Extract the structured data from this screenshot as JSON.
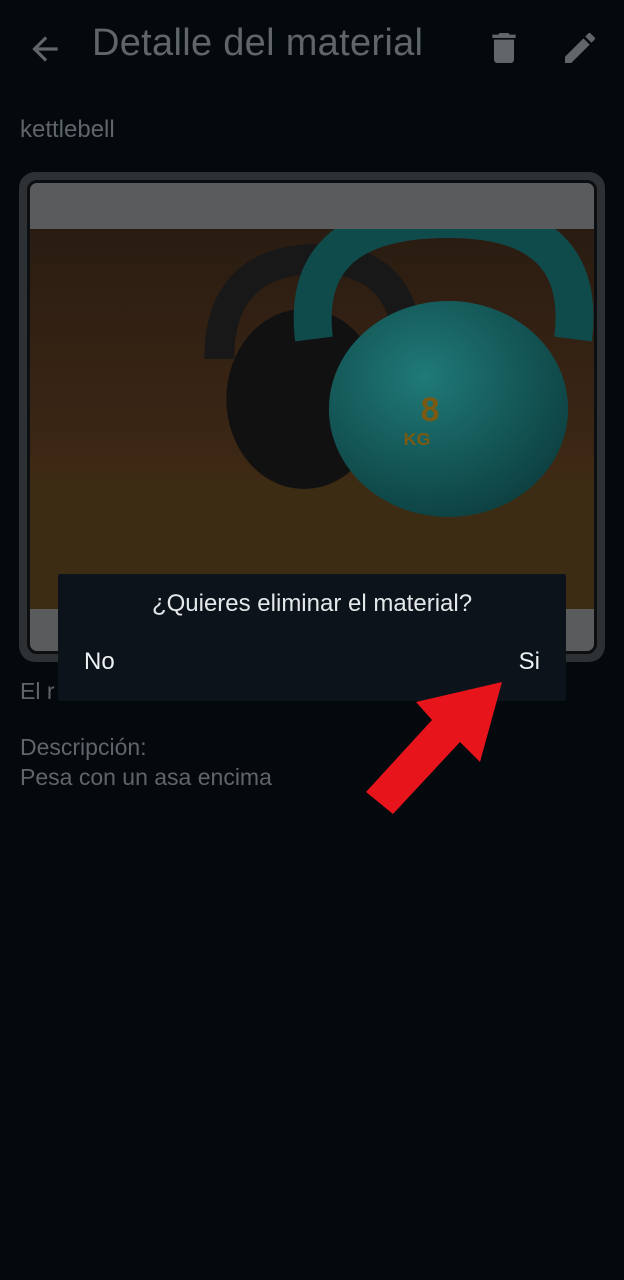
{
  "appbar": {
    "title": "Detalle del material",
    "back_icon": "arrow-left-icon",
    "delete_icon": "trash-icon",
    "edit_icon": "pencil-icon"
  },
  "material": {
    "name": "kettlebell",
    "availability_partial": "El r",
    "description_label": "Descripción:",
    "description": "Pesa con un asa encima",
    "photo_weight_text": "8",
    "photo_unit_text": "KG"
  },
  "dialog": {
    "question": "¿Quieres eliminar el material?",
    "no_label": "No",
    "yes_label": "Si"
  },
  "colors": {
    "background": "#03090d",
    "dialog_bg": "#0d131a",
    "annotation_arrow": "#e8141c"
  }
}
